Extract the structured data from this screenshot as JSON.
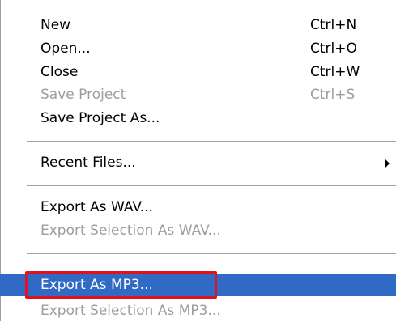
{
  "menu": {
    "items": [
      {
        "label": "New",
        "shortcut": "Ctrl+N",
        "enabled": true
      },
      {
        "label": "Open...",
        "shortcut": "Ctrl+O",
        "enabled": true
      },
      {
        "label": "Close",
        "shortcut": "Ctrl+W",
        "enabled": true
      },
      {
        "label": "Save Project",
        "shortcut": "Ctrl+S",
        "enabled": false
      },
      {
        "label": "Save Project As...",
        "shortcut": "",
        "enabled": true
      },
      {
        "label": "Recent Files...",
        "shortcut": "",
        "enabled": true,
        "submenu": true
      },
      {
        "label": "Export As WAV...",
        "shortcut": "",
        "enabled": true
      },
      {
        "label": "Export Selection As WAV...",
        "shortcut": "",
        "enabled": false
      },
      {
        "label": "Export As MP3...",
        "shortcut": "",
        "enabled": true,
        "highlighted": true
      },
      {
        "label": "Export Selection As MP3...",
        "shortcut": "",
        "enabled": false
      }
    ]
  },
  "colors": {
    "highlight": "#316ac5",
    "disabled_text": "#9d9d9d",
    "callout": "#e0121b"
  },
  "icons": {
    "submenu_arrow": "submenu-arrow-icon"
  }
}
